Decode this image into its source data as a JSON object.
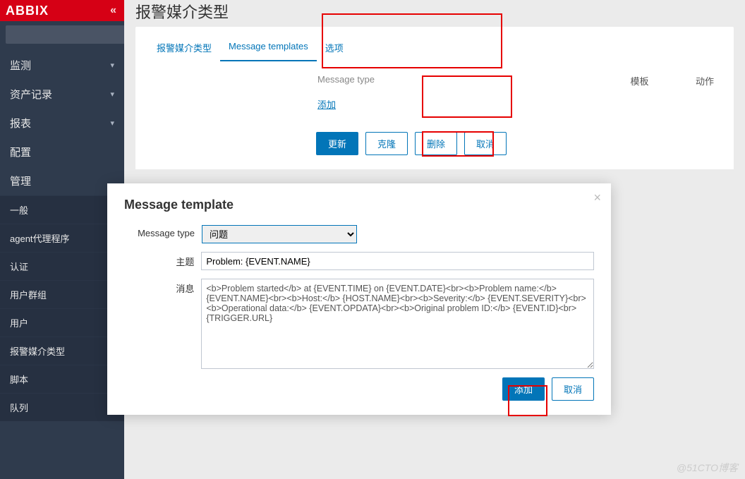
{
  "brand": "ABBIX",
  "sidebar": {
    "collapse_icon": "«",
    "search_placeholder": "",
    "groups": [
      {
        "label": "监测",
        "expandable": true
      },
      {
        "label": "资产记录",
        "expandable": true
      },
      {
        "label": "报表",
        "expandable": true
      },
      {
        "label": "配置",
        "expandable": true
      },
      {
        "label": "管理",
        "expandable": true,
        "open": true,
        "items": [
          "一般",
          "agent代理程序",
          "认证",
          "用户群组",
          "用户",
          "报警媒介类型",
          "脚本",
          "队列"
        ]
      }
    ]
  },
  "page_title": "报警媒介类型",
  "tabs": [
    {
      "label": "报警媒介类型",
      "active": false
    },
    {
      "label": "Message templates",
      "active": true
    },
    {
      "label": "选项",
      "active": false
    }
  ],
  "table_header": {
    "c1": "Message type",
    "c2": "模板",
    "c3": "动作"
  },
  "add_link": "添加",
  "buttons": [
    "更新",
    "克隆",
    "删除",
    "取消"
  ],
  "overlay": {
    "title": "Message template",
    "fields": {
      "type_label": "Message type",
      "type_value": "问题",
      "subject_label": "主题",
      "subject_value": "Problem: {EVENT.NAME}",
      "message_label": "消息",
      "message_value": "<b>Problem started</b> at {EVENT.TIME} on {EVENT.DATE}<br><b>Problem name:</b> {EVENT.NAME}<br><b>Host:</b> {HOST.NAME}<br><b>Severity:</b> {EVENT.SEVERITY}<br><b>Operational data:</b> {EVENT.OPDATA}<br><b>Original problem ID:</b> {EVENT.ID}<br>{TRIGGER.URL}"
    },
    "add": "添加",
    "cancel": "取消"
  },
  "watermark": "@51CTO博客"
}
